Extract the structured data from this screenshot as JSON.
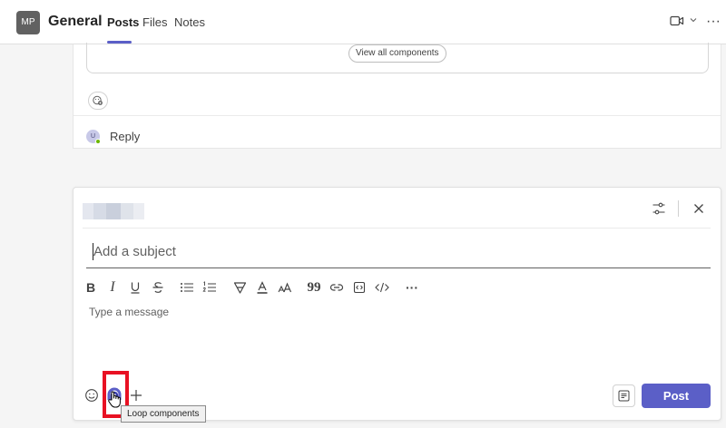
{
  "header": {
    "avatar_initials": "MP",
    "channel_name": "General",
    "tabs": [
      {
        "label": "Posts",
        "active": true
      },
      {
        "label": "Files",
        "active": false
      },
      {
        "label": "Notes",
        "active": false
      }
    ],
    "icons": [
      "video-icon",
      "chevron-down-icon",
      "more-icon"
    ],
    "more_glyph": "···"
  },
  "thread": {
    "view_all_label": "View all components",
    "reply_avatar_initial": "U",
    "reply_label": "Reply"
  },
  "compose": {
    "subject_placeholder": "Add a subject",
    "message_placeholder": "Type a message",
    "toolbar_items": [
      "bold",
      "italic",
      "underline",
      "strikethrough",
      "bulleted-list",
      "numbered-list",
      "highlight",
      "font-color",
      "font-size",
      "quote",
      "link",
      "insert-code",
      "code-block",
      "more"
    ],
    "bold_label": "B",
    "italic_label": "I",
    "quote_label": "99",
    "more_label": "···",
    "post_label": "Post",
    "tooltip": "Loop components"
  },
  "colors": {
    "accent": "#5b5fc7",
    "highlight_box": "#e81123",
    "presence": "#6bb700"
  }
}
